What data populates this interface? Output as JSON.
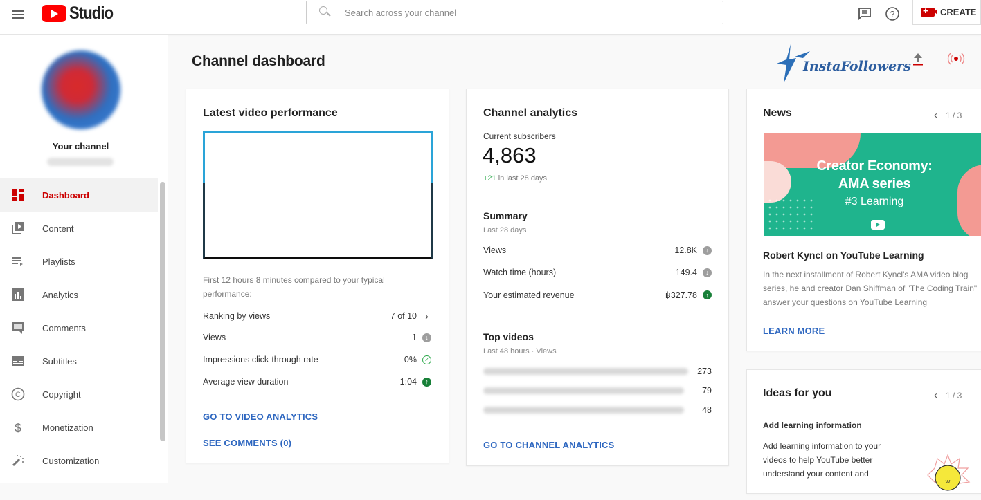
{
  "topbar": {
    "logo_text": "Studio",
    "search_placeholder": "Search across your channel",
    "create_label": "CREATE"
  },
  "sidebar": {
    "channel_label": "Your channel",
    "items": [
      {
        "label": "Dashboard",
        "icon": "dashboard-icon",
        "active": true
      },
      {
        "label": "Content",
        "icon": "content-icon"
      },
      {
        "label": "Playlists",
        "icon": "playlists-icon"
      },
      {
        "label": "Analytics",
        "icon": "analytics-icon"
      },
      {
        "label": "Comments",
        "icon": "comments-icon"
      },
      {
        "label": "Subtitles",
        "icon": "subtitles-icon"
      },
      {
        "label": "Copyright",
        "icon": "copyright-icon"
      },
      {
        "label": "Monetization",
        "icon": "monetization-icon"
      },
      {
        "label": "Customization",
        "icon": "customization-icon"
      }
    ]
  },
  "main": {
    "title": "Channel dashboard",
    "brand_text": "InstaFollowers",
    "accent_color": "#cc0000",
    "link_color": "#2e67c0"
  },
  "latest_video": {
    "title": "Latest video performance",
    "compare_text": "First 12 hours 8 minutes compared to your typical performance:",
    "rows": [
      {
        "label": "Ranking by views",
        "value": "7 of 10",
        "indicator": "chevron-right"
      },
      {
        "label": "Views",
        "value": "1",
        "indicator": "below-typical"
      },
      {
        "label": "Impressions click-through rate",
        "value": "0%",
        "indicator": "typical"
      },
      {
        "label": "Average view duration",
        "value": "1:04",
        "indicator": "above-typical"
      }
    ],
    "link_analytics": "GO TO VIDEO ANALYTICS",
    "link_comments": "SEE COMMENTS (0)"
  },
  "channel_analytics": {
    "title": "Channel analytics",
    "subscribers_label": "Current subscribers",
    "subscribers_value": "4,863",
    "subscribers_delta": "+21",
    "subscribers_delta_suffix": "in last 28 days",
    "summary_title": "Summary",
    "summary_period": "Last 28 days",
    "summary_rows": [
      {
        "label": "Views",
        "value": "12.8K",
        "indicator": "below-typical"
      },
      {
        "label": "Watch time (hours)",
        "value": "149.4",
        "indicator": "below-typical"
      },
      {
        "label": "Your estimated revenue",
        "value": "฿327.78",
        "indicator": "above-typical"
      }
    ],
    "top_videos_title": "Top videos",
    "top_videos_period": "Last 48 hours · Views",
    "top_videos": [
      {
        "views": "273"
      },
      {
        "views": "79"
      },
      {
        "views": "48"
      }
    ],
    "link": "GO TO CHANNEL ANALYTICS"
  },
  "news": {
    "title": "News",
    "pager": "1 / 3",
    "image_line1": "Creator Economy:",
    "image_line2": "AMA series",
    "image_line3": "#3 Learning",
    "headline": "Robert Kyncl on YouTube Learning",
    "body": "In the next installment of Robert Kyncl's AMA video blog series, he and creator Dan Shiffman of \"The Coding Train\" answer your questions on YouTube Learning",
    "link": "LEARN MORE"
  },
  "ideas": {
    "title": "Ideas for you",
    "pager": "1 / 3",
    "subtitle": "Add learning information",
    "body": "Add learning information to your videos to help YouTube better understand your content and"
  }
}
